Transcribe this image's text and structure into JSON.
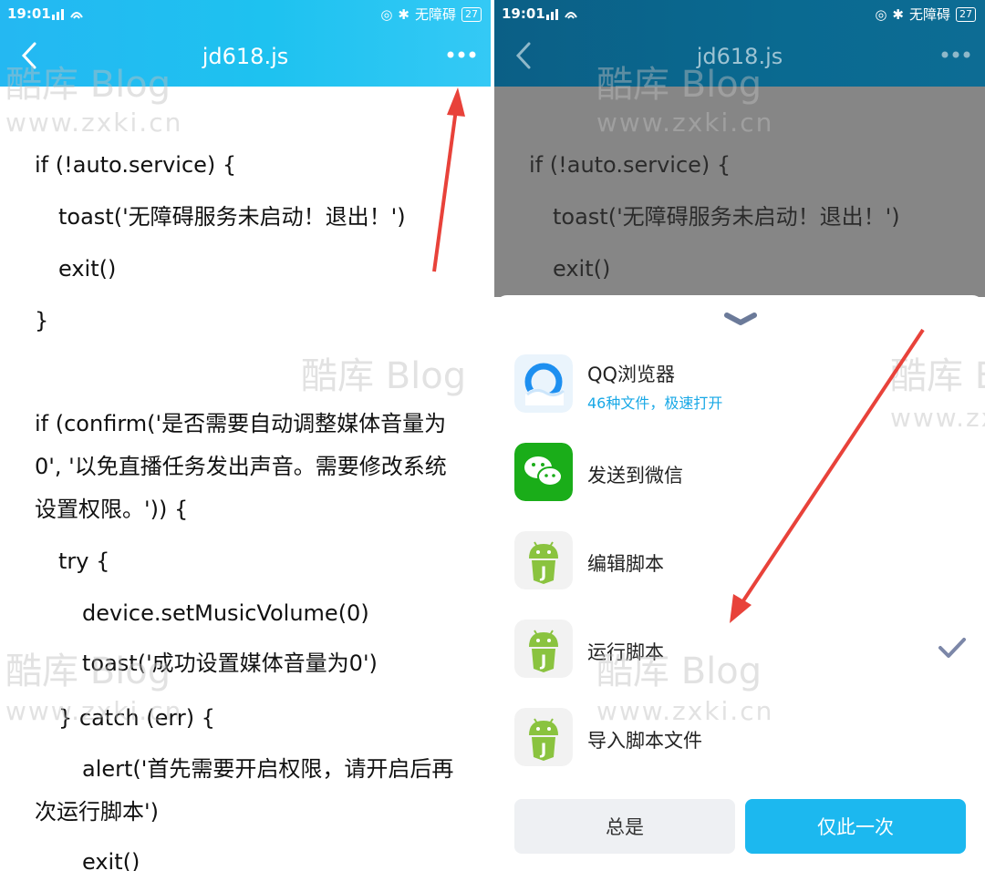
{
  "status_bar": {
    "time": "19:01",
    "accessibility": "无障碍",
    "battery": "27"
  },
  "editor": {
    "title": "jd618.js",
    "lines": [
      "if (!auto.service) {",
      "toast('无障碍服务未启动！退出！')",
      "exit()",
      "}",
      "if (confirm('是否需要自动调整媒体音量为0', '以免直播任务发出声音。需要修改系统设置权限。')) {",
      "try {",
      "device.setMusicVolume(0)",
      "toast('成功设置媒体音量为0')",
      "} catch (err) {",
      "alert('首先需要开启权限，请开启后再次运行脚本')",
      "exit()"
    ]
  },
  "chooser": {
    "items": [
      {
        "label": "QQ浏览器",
        "subtitle": "46种文件，极速打开",
        "icon": "qq-browser-icon"
      },
      {
        "label": "发送到微信",
        "icon": "wechat-icon"
      },
      {
        "label": "编辑脚本",
        "icon": "android-js-icon"
      },
      {
        "label": "运行脚本",
        "icon": "android-js-icon",
        "selected": true
      },
      {
        "label": "导入脚本文件",
        "icon": "android-js-icon"
      }
    ],
    "always_button": "总是",
    "once_button": "仅此一次"
  },
  "watermark": {
    "brand": "酷库 Blog",
    "url": "www.zxki.cn"
  },
  "colors": {
    "appbar": "#24b8f2",
    "accent": "#1cb8ef",
    "arrow": "#e8423a"
  }
}
